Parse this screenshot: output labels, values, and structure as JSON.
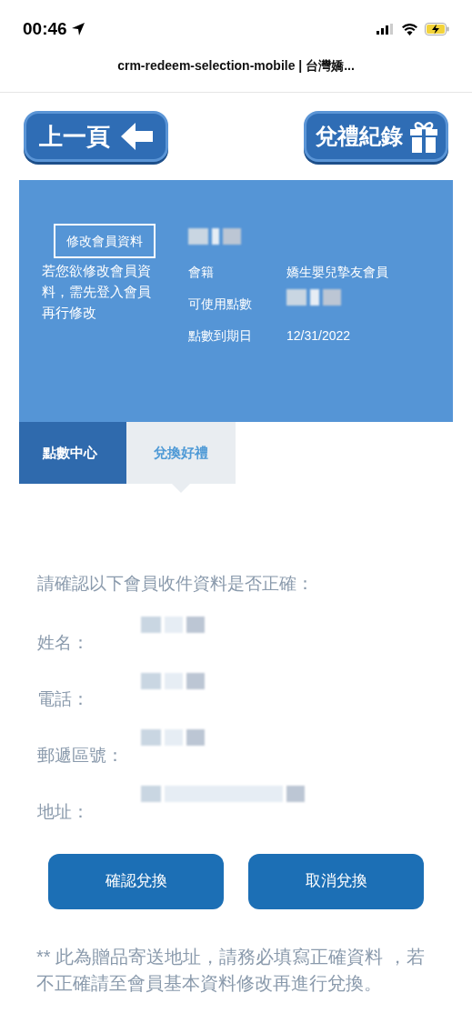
{
  "status_bar": {
    "time": "00:46"
  },
  "browser": {
    "title": "crm-redeem-selection-mobile | 台灣嬌..."
  },
  "nav": {
    "back": "上一頁",
    "history": "兌禮紀錄"
  },
  "member": {
    "edit_button": "修改會員資料",
    "edit_note": "若您欲修改會員資料，需先登入會員再行修改",
    "fields": [
      {
        "label": "會籍",
        "value": "嬌生嬰兒摯友會員",
        "redacted": false
      },
      {
        "label": "可使用點數",
        "redacted": true
      },
      {
        "label": "點數到期日",
        "value": "12/31/2022",
        "redacted": false
      }
    ]
  },
  "tabs": [
    {
      "label": "點數中心",
      "selected": false
    },
    {
      "label": "兌換好禮",
      "selected": true
    }
  ],
  "confirm": {
    "prompt": "請確認以下會員收件資料是否正確：",
    "rows": [
      {
        "label": "姓名："
      },
      {
        "label": "電話："
      },
      {
        "label": "郵遞區號："
      },
      {
        "label": "地址："
      }
    ]
  },
  "buttons": [
    "確認兌換",
    "取消兌換"
  ],
  "note": "** 此為贈品寄送地址，請務必填寫正確資料 ，若不正確請至會員基本資料修改再進行兌換。"
}
